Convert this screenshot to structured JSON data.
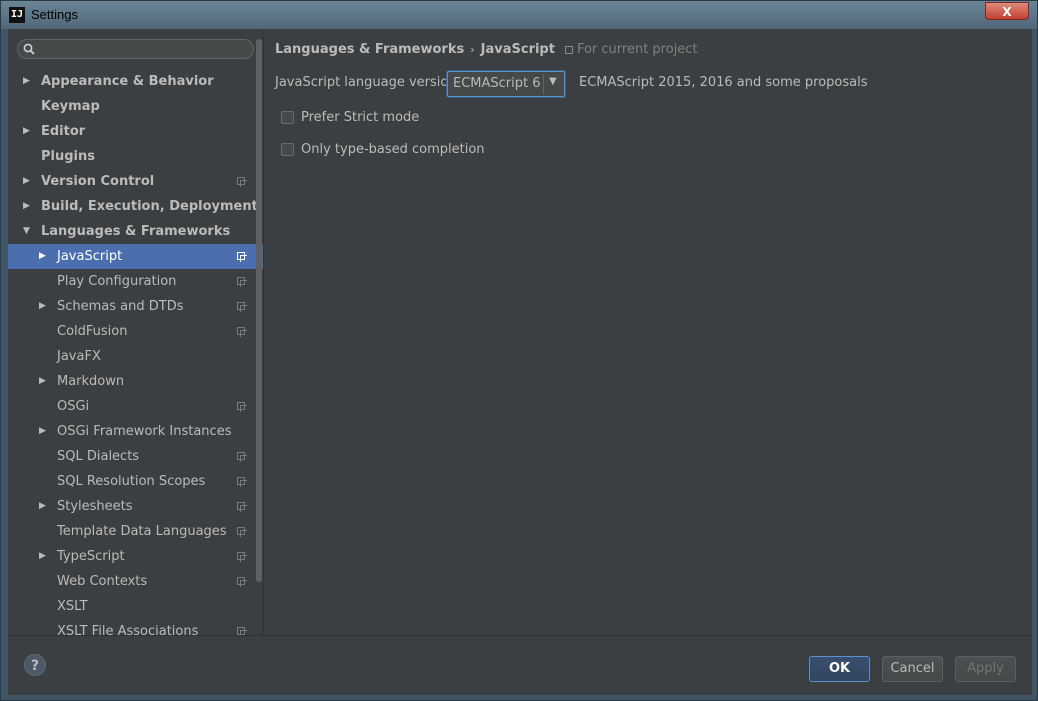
{
  "window": {
    "title": "Settings",
    "app_icon": "IJ",
    "close_glyph": "X"
  },
  "search": {
    "placeholder": "",
    "value": ""
  },
  "tree": [
    {
      "label": "Appearance & Behavior",
      "level": 0,
      "arrow": "right",
      "bold": true,
      "project_icon": false
    },
    {
      "label": "Keymap",
      "level": 0,
      "arrow": "none",
      "bold": true,
      "project_icon": false
    },
    {
      "label": "Editor",
      "level": 0,
      "arrow": "right",
      "bold": true,
      "project_icon": false
    },
    {
      "label": "Plugins",
      "level": 0,
      "arrow": "none",
      "bold": true,
      "project_icon": false
    },
    {
      "label": "Version Control",
      "level": 0,
      "arrow": "right",
      "bold": true,
      "project_icon": true
    },
    {
      "label": "Build, Execution, Deployment",
      "level": 0,
      "arrow": "right",
      "bold": true,
      "project_icon": false
    },
    {
      "label": "Languages & Frameworks",
      "level": 0,
      "arrow": "down",
      "bold": true,
      "project_icon": false
    },
    {
      "label": "JavaScript",
      "level": 1,
      "arrow": "right",
      "bold": false,
      "project_icon": true,
      "selected": true
    },
    {
      "label": "Play Configuration",
      "level": 1,
      "arrow": "none",
      "bold": false,
      "project_icon": true
    },
    {
      "label": "Schemas and DTDs",
      "level": 1,
      "arrow": "right",
      "bold": false,
      "project_icon": true
    },
    {
      "label": "ColdFusion",
      "level": 1,
      "arrow": "none",
      "bold": false,
      "project_icon": true
    },
    {
      "label": "JavaFX",
      "level": 1,
      "arrow": "none",
      "bold": false,
      "project_icon": false
    },
    {
      "label": "Markdown",
      "level": 1,
      "arrow": "right",
      "bold": false,
      "project_icon": false
    },
    {
      "label": "OSGi",
      "level": 1,
      "arrow": "none",
      "bold": false,
      "project_icon": true
    },
    {
      "label": "OSGi Framework Instances",
      "level": 1,
      "arrow": "right",
      "bold": false,
      "project_icon": false
    },
    {
      "label": "SQL Dialects",
      "level": 1,
      "arrow": "none",
      "bold": false,
      "project_icon": true
    },
    {
      "label": "SQL Resolution Scopes",
      "level": 1,
      "arrow": "none",
      "bold": false,
      "project_icon": true
    },
    {
      "label": "Stylesheets",
      "level": 1,
      "arrow": "right",
      "bold": false,
      "project_icon": true
    },
    {
      "label": "Template Data Languages",
      "level": 1,
      "arrow": "none",
      "bold": false,
      "project_icon": true
    },
    {
      "label": "TypeScript",
      "level": 1,
      "arrow": "right",
      "bold": false,
      "project_icon": true
    },
    {
      "label": "Web Contexts",
      "level": 1,
      "arrow": "none",
      "bold": false,
      "project_icon": true
    },
    {
      "label": "XSLT",
      "level": 1,
      "arrow": "none",
      "bold": false,
      "project_icon": false
    },
    {
      "label": "XSLT File Associations",
      "level": 1,
      "arrow": "none",
      "bold": false,
      "project_icon": true
    }
  ],
  "content": {
    "breadcrumb": {
      "parent": "Languages & Frameworks",
      "separator": "›",
      "current": "JavaScript",
      "scope": "For current project"
    },
    "language_version": {
      "label": "JavaScript language version",
      "selected": "ECMAScript 6",
      "description": "ECMAScript 2015, 2016 and some proposals"
    },
    "options": [
      {
        "label": "Prefer Strict mode",
        "checked": false
      },
      {
        "label": "Only type-based completion",
        "checked": false
      }
    ]
  },
  "footer": {
    "help": "?",
    "ok": "OK",
    "cancel": "Cancel",
    "apply": "Apply"
  },
  "colors": {
    "selection": "#4b6eaf",
    "background": "#3c3f41",
    "text": "#bbbbbb",
    "focus": "#5a8fd0"
  }
}
